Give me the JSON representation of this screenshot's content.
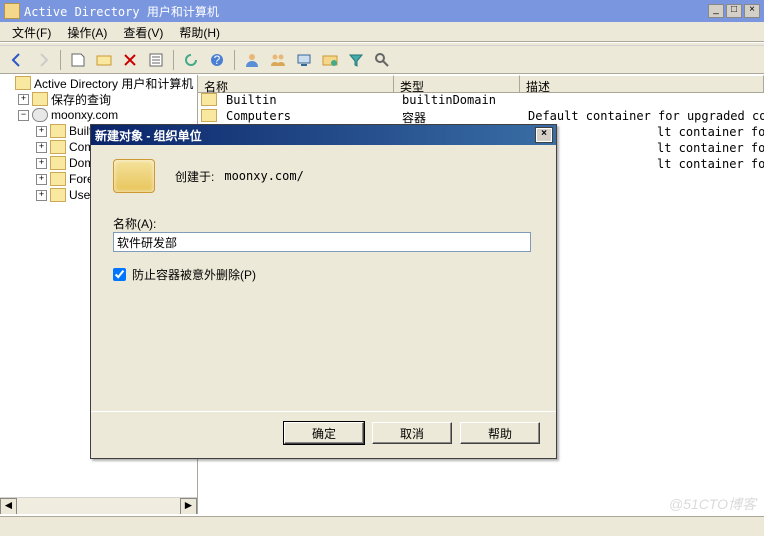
{
  "window": {
    "title": "Active Directory 用户和计算机"
  },
  "menu": {
    "file": "文件(F)",
    "action": "操作(A)",
    "view": "查看(V)",
    "help": "帮助(H)"
  },
  "tree": {
    "root": "Active Directory 用户和计算机",
    "saved": "保存的查询",
    "domain": "moonxy.com",
    "children": [
      "Built",
      "Compu",
      "Domai",
      "Forei",
      "Users"
    ]
  },
  "list": {
    "headers": {
      "name": "名称",
      "type": "类型",
      "desc": "描述"
    },
    "rows": [
      {
        "name": "Builtin",
        "type": "builtinDomain",
        "desc": ""
      },
      {
        "name": "Computers",
        "type": "容器",
        "desc": "Default container for upgraded com..."
      },
      {
        "name": "",
        "type": "",
        "desc": "lt container for domain contr..."
      },
      {
        "name": "",
        "type": "",
        "desc": "lt container for security ide..."
      },
      {
        "name": "",
        "type": "",
        "desc": "lt container for upgraded use..."
      }
    ]
  },
  "dialog": {
    "title": "新建对象 - 组织单位",
    "created_label": "创建于:",
    "created_path": "moonxy.com/",
    "name_label": "名称(A):",
    "name_value": "软件研发部",
    "protect_label": "防止容器被意外删除(P)",
    "protect_checked": true,
    "buttons": {
      "ok": "确定",
      "cancel": "取消",
      "help": "帮助"
    }
  },
  "watermark": "@51CTO博客"
}
